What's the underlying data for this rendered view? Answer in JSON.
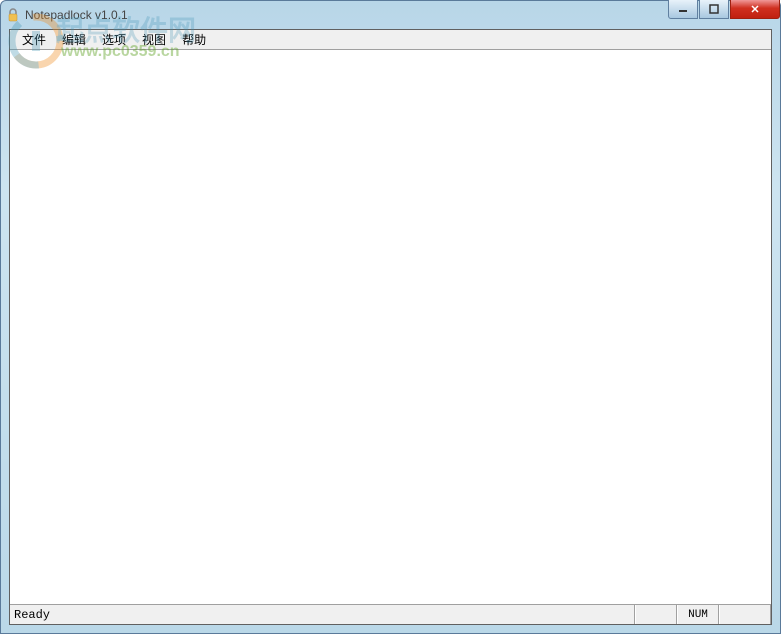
{
  "window": {
    "title": "Notepadlock v1.0.1"
  },
  "menu": {
    "items": [
      {
        "label": "文件"
      },
      {
        "label": "编辑"
      },
      {
        "label": "选项"
      },
      {
        "label": "视图"
      },
      {
        "label": "帮助"
      }
    ]
  },
  "editor": {
    "content": ""
  },
  "statusbar": {
    "ready": "Ready",
    "num": "NUM",
    "cell1": "",
    "cell3": ""
  },
  "watermark": {
    "text_cn": "起点软件网",
    "url": "www.pc0359.cn"
  }
}
